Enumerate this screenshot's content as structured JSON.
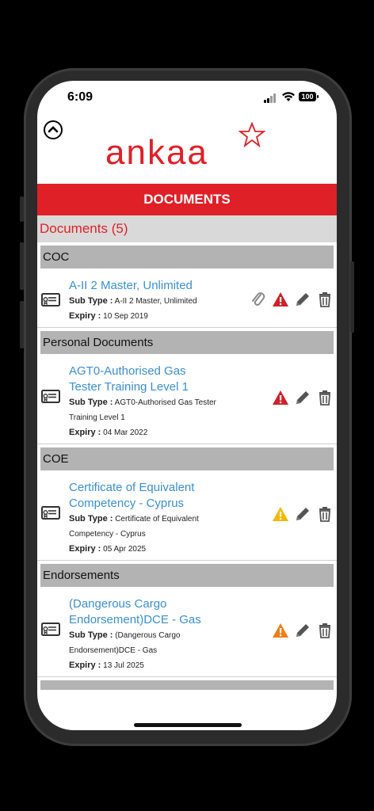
{
  "status": {
    "time": "6:09",
    "battery": "100"
  },
  "brand": {
    "logo_text": "ankaa"
  },
  "page": {
    "title": "DOCUMENTS",
    "count_label": "Documents (5)"
  },
  "labels": {
    "sub_type": "Sub Type :",
    "expiry": "Expiry :"
  },
  "sections": [
    {
      "header": "COC",
      "items": [
        {
          "title": "A-II 2 Master, Unlimited",
          "sub_type": "A-II 2 Master, Unlimited",
          "expiry": "10 Sep 2019",
          "has_attachment": true,
          "warning_color": "#d0212b"
        }
      ]
    },
    {
      "header": "Personal Documents",
      "items": [
        {
          "title": "AGT0-Authorised Gas Tester Training Level 1",
          "sub_type": "AGT0-Authorised Gas Tester Training Level 1",
          "expiry": "04 Mar 2022",
          "has_attachment": false,
          "warning_color": "#d0212b"
        }
      ]
    },
    {
      "header": "COE",
      "items": [
        {
          "title": "Certificate of Equivalent Competency - Cyprus",
          "sub_type": "Certificate of Equivalent Competency - Cyprus",
          "expiry": "05 Apr 2025",
          "has_attachment": false,
          "warning_color": "#f5b800"
        }
      ]
    },
    {
      "header": "Endorsements",
      "items": [
        {
          "title": "(Dangerous Cargo Endorsement)DCE - Gas",
          "sub_type": "(Dangerous Cargo Endorsement)DCE - Gas",
          "expiry": "13 Jul 2025",
          "has_attachment": false,
          "warning_color": "#f07d16"
        }
      ]
    }
  ],
  "colors": {
    "brand_red": "#e02027",
    "link_blue": "#3a8fd0",
    "section_gray": "#b3b3b3"
  },
  "icons": {
    "collapse": "chevron-up-icon",
    "document": "certificate-icon",
    "attach": "paperclip-icon",
    "warning": "warning-triangle-icon",
    "edit": "pencil-icon",
    "delete": "trash-icon"
  }
}
